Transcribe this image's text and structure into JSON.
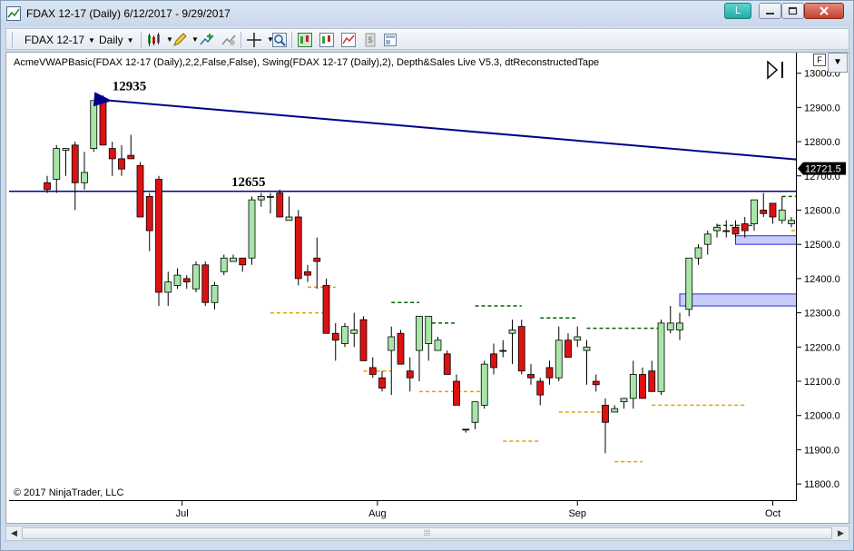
{
  "window": {
    "title": "FDAX 12-17 (Daily)  6/12/2017 - 9/29/2017",
    "link_button": "L",
    "min_icon": "minimize-icon",
    "max_icon": "maximize-icon",
    "close_icon": "close-icon"
  },
  "toolbar": {
    "instrument": "FDAX 12-17",
    "interval": "Daily",
    "icons": [
      "chart-style-icon",
      "draw-tools-icon",
      "add-indicator-icon",
      "strategy-icon",
      "crosshair-icon",
      "zoom-icon",
      "data-box-icon",
      "chart-trader-icon",
      "properties-icon",
      "templates-icon",
      "sidebar-icon"
    ]
  },
  "chart": {
    "indicator_label": "AcmeVWAPBasic(FDAX 12-17 (Daily),2,2,False,False), Swing(FDAX 12-17 (Daily),2), Depth&Sales Live V5.3, dtReconstructedTape",
    "copyright": "© 2017 NinjaTrader, LLC",
    "current_price": "12721.5",
    "annotations": [
      {
        "text": "12935"
      },
      {
        "text": "12655"
      }
    ],
    "f_button": "F",
    "colors": {
      "up": "#a8e6a8",
      "down": "#dd1111",
      "line": "#00008b",
      "swing_high": "#006400",
      "swing_low": "#e6a000",
      "zone": "#c8ccf8",
      "price_tag": "#000000"
    }
  },
  "chart_data": {
    "type": "candlestick",
    "ylim": [
      11750,
      13060
    ],
    "yticks": [
      "13000.0",
      "12900.0",
      "12800.0",
      "12700.0",
      "12600.0",
      "12500.0",
      "12400.0",
      "12300.0",
      "12200.0",
      "12100.0",
      "12000.0",
      "11900.0",
      "11800.0"
    ],
    "ytick_values": [
      13000,
      12900,
      12800,
      12700,
      12600,
      12500,
      12400,
      12300,
      12200,
      12100,
      12000,
      11900,
      11800
    ],
    "xticks": [
      "Jul",
      "Aug",
      "Sep",
      "Oct"
    ],
    "xtick_index": [
      14.5,
      35.5,
      57,
      78
    ],
    "candles": [
      [
        12660,
        12700,
        12650,
        12680,
        "d"
      ],
      [
        12690,
        12790,
        12650,
        12780,
        "u"
      ],
      [
        12775,
        12780,
        12700,
        12780,
        "u"
      ],
      [
        12790,
        12800,
        12600,
        12680,
        "d"
      ],
      [
        12680,
        12770,
        12660,
        12710,
        "u"
      ],
      [
        12780,
        12900,
        12770,
        12920,
        "u"
      ],
      [
        12920,
        12935,
        12790,
        12790,
        "d"
      ],
      [
        12780,
        12800,
        12700,
        12750,
        "d"
      ],
      [
        12750,
        12790,
        12700,
        12720,
        "d"
      ],
      [
        12760,
        12820,
        12750,
        12750,
        "d"
      ],
      [
        12730,
        12740,
        12650,
        12580,
        "d"
      ],
      [
        12640,
        12650,
        12480,
        12540,
        "d"
      ],
      [
        12690,
        12700,
        12320,
        12360,
        "d"
      ],
      [
        12360,
        12420,
        12320,
        12390,
        "u"
      ],
      [
        12380,
        12430,
        12370,
        12410,
        "u"
      ],
      [
        12400,
        12410,
        12370,
        12390,
        "d"
      ],
      [
        12370,
        12450,
        12360,
        12440,
        "u"
      ],
      [
        12440,
        12450,
        12320,
        12330,
        "d"
      ],
      [
        12330,
        12390,
        12310,
        12380,
        "u"
      ],
      [
        12420,
        12470,
        12410,
        12460,
        "u"
      ],
      [
        12450,
        12470,
        12450,
        12460,
        "u"
      ],
      [
        12460,
        12460,
        12420,
        12440,
        "d"
      ],
      [
        12460,
        12640,
        12440,
        12630,
        "u"
      ],
      [
        12630,
        12650,
        12610,
        12640,
        "u"
      ],
      [
        12640,
        12650,
        12590,
        12640,
        "u"
      ],
      [
        12650,
        12660,
        12580,
        12580,
        "d"
      ],
      [
        12580,
        12640,
        12580,
        12570,
        "u"
      ],
      [
        12580,
        12600,
        12380,
        12400,
        "d"
      ],
      [
        12410,
        12440,
        12390,
        12420,
        "d"
      ],
      [
        12450,
        12520,
        12370,
        12460,
        "d"
      ],
      [
        12380,
        12400,
        12240,
        12240,
        "d"
      ],
      [
        12240,
        12270,
        12160,
        12220,
        "d"
      ],
      [
        12260,
        12270,
        12200,
        12210,
        "u"
      ],
      [
        12250,
        12300,
        12200,
        12240,
        "u"
      ],
      [
        12280,
        12290,
        12170,
        12160,
        "d"
      ],
      [
        12140,
        12170,
        12110,
        12120,
        "d"
      ],
      [
        12110,
        12130,
        12070,
        12080,
        "d"
      ],
      [
        12190,
        12260,
        12060,
        12230,
        "u"
      ],
      [
        12240,
        12250,
        12170,
        12150,
        "d"
      ],
      [
        12130,
        12170,
        12070,
        12110,
        "d"
      ],
      [
        12190,
        12290,
        12100,
        12290,
        "u"
      ],
      [
        12290,
        12290,
        12160,
        12210,
        "u"
      ],
      [
        12220,
        12230,
        12190,
        12190,
        "u"
      ],
      [
        12180,
        12190,
        12120,
        12120,
        "d"
      ],
      [
        12100,
        12120,
        12030,
        12030,
        "d"
      ],
      [
        11960,
        11960,
        11950,
        11960,
        "d"
      ],
      [
        11980,
        12040,
        11960,
        12040,
        "u"
      ],
      [
        12030,
        12160,
        12020,
        12150,
        "u"
      ],
      [
        12140,
        12210,
        12120,
        12180,
        "d"
      ],
      [
        12190,
        12220,
        12170,
        12190,
        "d"
      ],
      [
        12240,
        12280,
        12150,
        12250,
        "u"
      ],
      [
        12260,
        12280,
        12120,
        12130,
        "d"
      ],
      [
        12120,
        12150,
        12090,
        12110,
        "d"
      ],
      [
        12100,
        12110,
        12030,
        12060,
        "d"
      ],
      [
        12140,
        12160,
        12090,
        12110,
        "d"
      ],
      [
        12110,
        12260,
        12100,
        12220,
        "u"
      ],
      [
        12220,
        12240,
        12170,
        12170,
        "d"
      ],
      [
        12230,
        12260,
        12200,
        12220,
        "u"
      ],
      [
        12190,
        12220,
        12090,
        12200,
        "u"
      ],
      [
        12100,
        12120,
        12070,
        12090,
        "d"
      ],
      [
        12030,
        12050,
        11890,
        11980,
        "d"
      ],
      [
        12010,
        12030,
        12010,
        12020,
        "u"
      ],
      [
        12040,
        12050,
        12020,
        12050,
        "u"
      ],
      [
        12050,
        12160,
        12020,
        12120,
        "u"
      ],
      [
        12120,
        12140,
        12070,
        12050,
        "d"
      ],
      [
        12130,
        12160,
        12070,
        12070,
        "d"
      ],
      [
        12070,
        12280,
        12060,
        12270,
        "u"
      ],
      [
        12270,
        12320,
        12240,
        12250,
        "u"
      ],
      [
        12250,
        12300,
        12220,
        12270,
        "u"
      ],
      [
        12310,
        12460,
        12290,
        12460,
        "u"
      ],
      [
        12460,
        12500,
        12440,
        12490,
        "u"
      ],
      [
        12500,
        12540,
        12470,
        12530,
        "u"
      ],
      [
        12540,
        12560,
        12520,
        12550,
        "u"
      ],
      [
        12540,
        12570,
        12520,
        12540,
        "d"
      ],
      [
        12550,
        12570,
        12520,
        12530,
        "d"
      ],
      [
        12540,
        12580,
        12520,
        12560,
        "d"
      ],
      [
        12560,
        12630,
        12540,
        12630,
        "u"
      ],
      [
        12590,
        12650,
        12580,
        12600,
        "d"
      ],
      [
        12580,
        12620,
        12560,
        12620,
        "d"
      ],
      [
        12570,
        12640,
        12560,
        12600,
        "u"
      ],
      [
        12560,
        12580,
        12550,
        12570,
        "u"
      ],
      [
        12560,
        12610,
        12560,
        12600,
        "u"
      ],
      [
        12630,
        12690,
        12610,
        12680,
        "u"
      ],
      [
        12670,
        12720,
        12660,
        12720,
        "u"
      ],
      [
        12720,
        12730,
        12710,
        12722,
        "u"
      ]
    ],
    "horizontal_line": 12655,
    "trend_line": {
      "from": [
        6,
        12920
      ],
      "to": [
        84,
        12740
      ]
    },
    "swing_highs": [
      {
        "from": 26,
        "to": 35,
        "price": 12655
      },
      {
        "from": 37,
        "to": 40,
        "price": 12330
      },
      {
        "from": 40,
        "to": 44,
        "price": 12270
      },
      {
        "from": 46,
        "to": 51,
        "price": 12320
      },
      {
        "from": 53,
        "to": 57,
        "price": 12285
      },
      {
        "from": 58,
        "to": 66,
        "price": 12255
      },
      {
        "from": 72,
        "to": 76,
        "price": 12555
      },
      {
        "from": 79,
        "to": 83,
        "price": 12640
      }
    ],
    "swing_lows": [
      {
        "from": 24,
        "to": 30,
        "price": 12300
      },
      {
        "from": 28,
        "to": 31,
        "price": 12375
      },
      {
        "from": 34,
        "to": 37,
        "price": 12130
      },
      {
        "from": 40,
        "to": 47,
        "price": 12070
      },
      {
        "from": 49,
        "to": 53,
        "price": 11925
      },
      {
        "from": 55,
        "to": 60,
        "price": 12010
      },
      {
        "from": 61,
        "to": 64,
        "price": 11865
      },
      {
        "from": 65,
        "to": 75,
        "price": 12030
      },
      {
        "from": 80,
        "to": 83,
        "price": 12540
      }
    ],
    "zones": [
      {
        "from": 68,
        "to": 82,
        "low": 12320,
        "high": 12355
      },
      {
        "from": 74,
        "to": 86,
        "low": 12500,
        "high": 12525
      }
    ]
  },
  "scrollbar": {
    "grip": "⁞⁞⁞"
  }
}
